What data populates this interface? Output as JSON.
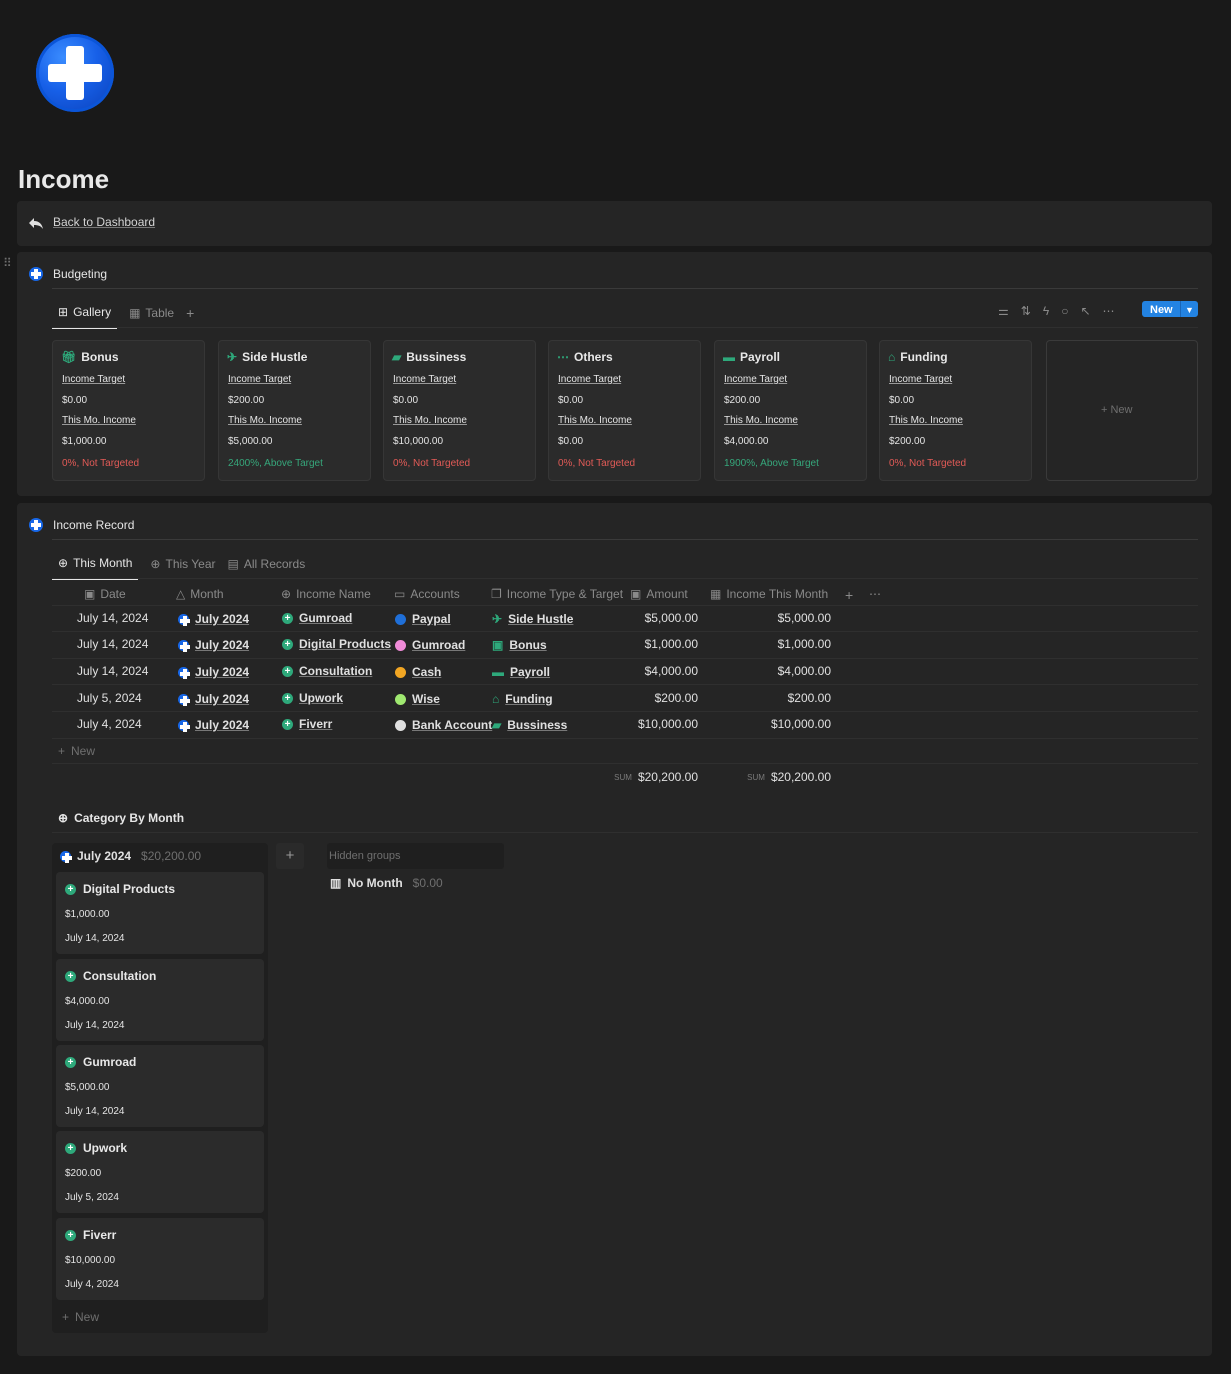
{
  "page": {
    "title": "Income",
    "back_link": "Back to Dashboard"
  },
  "budgeting": {
    "title": "Budgeting",
    "tabs": [
      "Gallery",
      "Table"
    ],
    "new_button": "New",
    "new_card": "+ New",
    "cards": [
      {
        "name": "Bonus",
        "icon": "gift-icon",
        "target_label": "Income Target",
        "target": "$0.00",
        "income_label": "This Mo. Income",
        "income": "$1,000.00",
        "status": "0%, Not Targeted",
        "status_color": "#e25b57"
      },
      {
        "name": "Side Hustle",
        "icon": "airplane-icon",
        "target_label": "Income Target",
        "target": "$200.00",
        "income_label": "This Mo. Income",
        "income": "$5,000.00",
        "status": "2400%, Above Target",
        "status_color": "#36a77b"
      },
      {
        "name": "Bussiness",
        "icon": "briefcase-icon",
        "target_label": "Income Target",
        "target": "$0.00",
        "income_label": "This Mo. Income",
        "income": "$10,000.00",
        "status": "0%, Not Targeted",
        "status_color": "#e25b57"
      },
      {
        "name": "Others",
        "icon": "more-icon",
        "target_label": "Income Target",
        "target": "$0.00",
        "income_label": "This Mo. Income",
        "income": "$0.00",
        "status": "0%, Not Targeted",
        "status_color": "#e25b57"
      },
      {
        "name": "Payroll",
        "icon": "money-icon",
        "target_label": "Income Target",
        "target": "$200.00",
        "income_label": "This Mo. Income",
        "income": "$4,000.00",
        "status": "1900%, Above Target",
        "status_color": "#36a77b"
      },
      {
        "name": "Funding",
        "icon": "bank-icon",
        "target_label": "Income Target",
        "target": "$0.00",
        "income_label": "This Mo. Income",
        "income": "$200.00",
        "status": "0%, Not Targeted",
        "status_color": "#e25b57"
      }
    ]
  },
  "income_record": {
    "title": "Income Record",
    "tabs": [
      "This Month",
      "This Year",
      "All Records"
    ],
    "columns": [
      "Date",
      "Month",
      "Income Name",
      "Accounts",
      "Income Type & Target",
      "Amount",
      "Income This Month"
    ],
    "rows": [
      {
        "date": "July 14, 2024",
        "month": "July 2024",
        "name": "Gumroad",
        "account": "Paypal",
        "account_color": "#1f6fd8",
        "type": "Side Hustle",
        "amount": "$5,000.00",
        "month_total": "$5,000.00"
      },
      {
        "date": "July 14, 2024",
        "month": "July 2024",
        "name": "Digital Products",
        "account": "Gumroad",
        "account_color": "#f08bd8",
        "type": "Bonus",
        "amount": "$1,000.00",
        "month_total": "$1,000.00"
      },
      {
        "date": "July 14, 2024",
        "month": "July 2024",
        "name": "Consultation",
        "account": "Cash",
        "account_color": "#f2a623",
        "type": "Payroll",
        "amount": "$4,000.00",
        "month_total": "$4,000.00"
      },
      {
        "date": "July 5, 2024",
        "month": "July 2024",
        "name": "Upwork",
        "account": "Wise",
        "account_color": "#9fe870",
        "type": "Funding",
        "amount": "$200.00",
        "month_total": "$200.00"
      },
      {
        "date": "July 4, 2024",
        "month": "July 2024",
        "name": "Fiverr",
        "account": "Bank Account",
        "account_color": "#e0e0e0",
        "type": "Bussiness",
        "amount": "$10,000.00",
        "month_total": "$10,000.00"
      }
    ],
    "new_row": "New",
    "sum_label": "SUM",
    "sum_amount": "$20,200.00",
    "sum_month_total": "$20,200.00"
  },
  "category_by_month": {
    "title": "Category By Month",
    "group_label": "July 2024",
    "group_total": "$20,200.00",
    "hidden_groups": "Hidden groups",
    "no_month": "No Month",
    "no_month_total": "$0.00",
    "new_label": "New",
    "cards": [
      {
        "name": "Digital Products",
        "amount": "$1,000.00",
        "date": "July 14, 2024"
      },
      {
        "name": "Consultation",
        "amount": "$4,000.00",
        "date": "July 14, 2024"
      },
      {
        "name": "Gumroad",
        "amount": "$5,000.00",
        "date": "July 14, 2024"
      },
      {
        "name": "Upwork",
        "amount": "$200.00",
        "date": "July 5, 2024"
      },
      {
        "name": "Fiverr",
        "amount": "$10,000.00",
        "date": "July 4, 2024"
      }
    ]
  }
}
